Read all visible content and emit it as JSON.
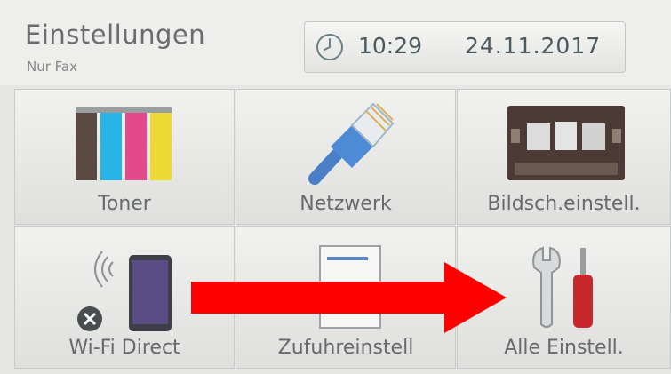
{
  "header": {
    "title": "Einstellungen",
    "subtitle": "Nur Fax",
    "time": "10:29",
    "date": "24.11.2017"
  },
  "tiles": [
    {
      "label": "Toner",
      "icon": "toner-cartridges-icon"
    },
    {
      "label": "Netzwerk",
      "icon": "network-cable-icon"
    },
    {
      "label": "Bildsch.einstell.",
      "icon": "display-settings-icon"
    },
    {
      "label": "Wi-Fi Direct",
      "icon": "wifi-direct-phone-icon"
    },
    {
      "label": "Zufuhreinstell",
      "icon": "paper-tray-document-icon"
    },
    {
      "label": "Alle Einstell.",
      "icon": "wrench-screwdriver-icon"
    }
  ],
  "colors": {
    "toner_black": "#5b4a42",
    "toner_cyan": "#27b5e8",
    "toner_magenta": "#e44a8b",
    "toner_yellow": "#ecd935",
    "overlay_arrow": "#ff0000"
  }
}
